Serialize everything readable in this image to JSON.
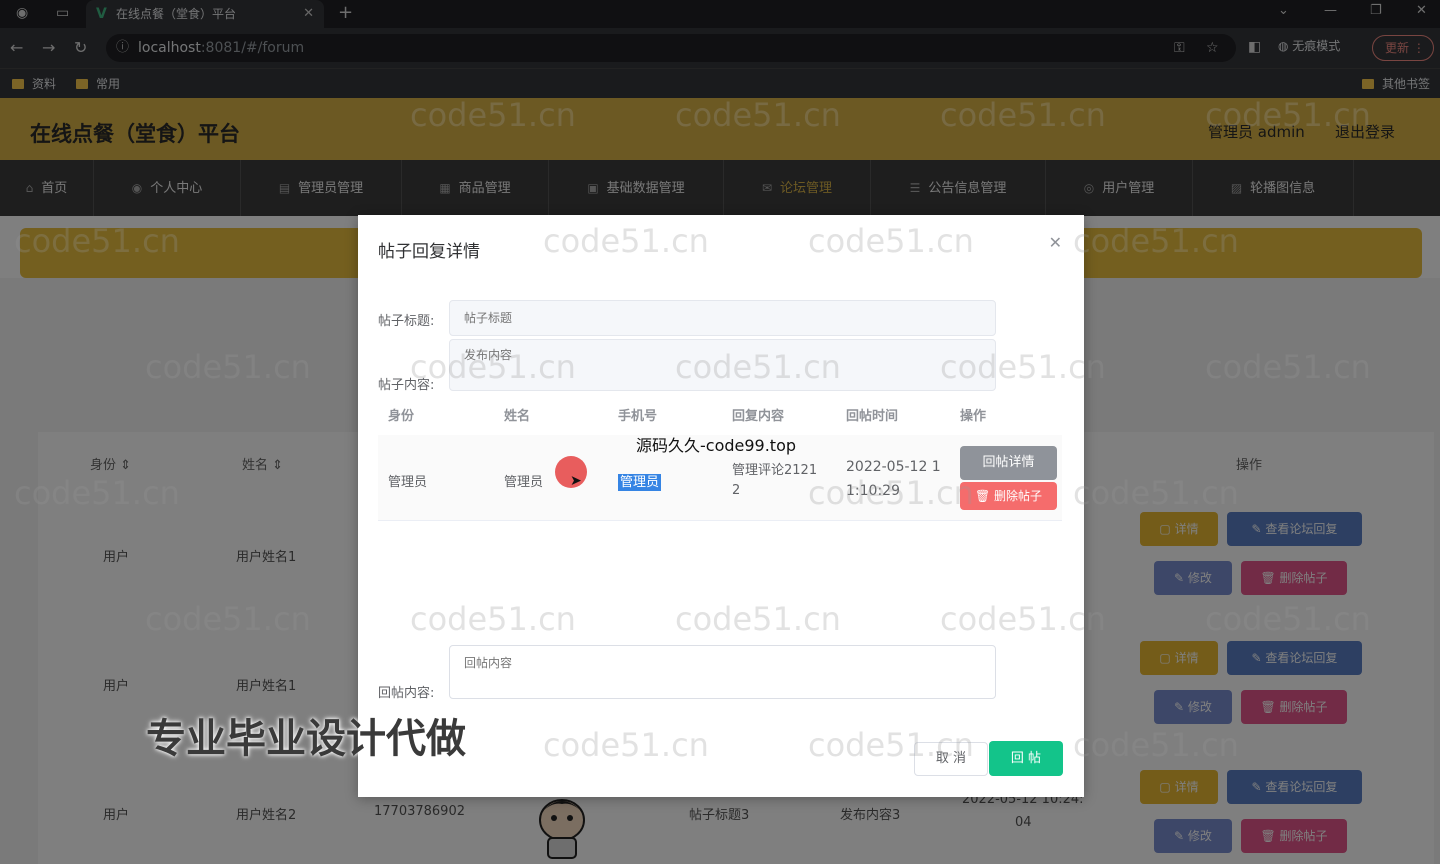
{
  "browser": {
    "tab_title": "在线点餐（堂食）平台",
    "url_host": "localhost",
    "url_path": ":8081/#/forum",
    "incognito_label": "无痕模式",
    "update_label": "更新",
    "bookmarks": [
      "资料",
      "常用"
    ],
    "other_bookmarks": "其他书签"
  },
  "app": {
    "title": "在线点餐（堂食）平台",
    "user_label": "管理员 admin",
    "logout_label": "退出登录",
    "menu": [
      "首页",
      "个人中心",
      "管理员管理",
      "商品管理",
      "基础数据管理",
      "论坛管理",
      "公告信息管理",
      "用户管理",
      "轮播图信息"
    ]
  },
  "table": {
    "headers": {
      "identity": "身份",
      "name": "姓名",
      "action": "操作"
    },
    "rows": [
      {
        "identity": "用户",
        "name": "用户姓名1",
        "phone": "",
        "title": "",
        "content": "",
        "time": ""
      },
      {
        "identity": "用户",
        "name": "用户姓名1",
        "phone": "",
        "title": "",
        "content": "",
        "time": ""
      },
      {
        "identity": "用户",
        "name": "用户姓名2",
        "phone": "17703786902",
        "title": "帖子标题3",
        "content": "发布内容3",
        "time_line1": "2022-05-12 10:24:",
        "time_line2": "04"
      }
    ],
    "row_buttons": {
      "detail": "详情",
      "view_reply": "查看论坛回复",
      "edit": "修改",
      "delete": "删除帖子"
    }
  },
  "dialog": {
    "title": "帖子回复详情",
    "title_label": "帖子标题:",
    "title_placeholder": "帖子标题",
    "content_label": "帖子内容:",
    "content_placeholder": "发布内容",
    "columns": [
      "身份",
      "姓名",
      "手机号",
      "回复内容",
      "回帖时间",
      "操作"
    ],
    "reply": {
      "identity": "管理员",
      "name": "管理员",
      "phone": "管理员",
      "content_line1": "管理评论2121",
      "content_line2": "2",
      "time_line1": "2022-05-12 1",
      "time_line2": "1:10:29"
    },
    "reply_detail_button": "回帖详情",
    "delete_button": "删除帖子",
    "reply_content_label": "回帖内容:",
    "reply_content_placeholder": "回帖内容",
    "cancel": "取 消",
    "submit": "回 帖"
  },
  "overlays": {
    "watermark": "code51.cn",
    "source_text": "源码久久-code99.top",
    "promo_text": "专业毕业设计代做"
  }
}
